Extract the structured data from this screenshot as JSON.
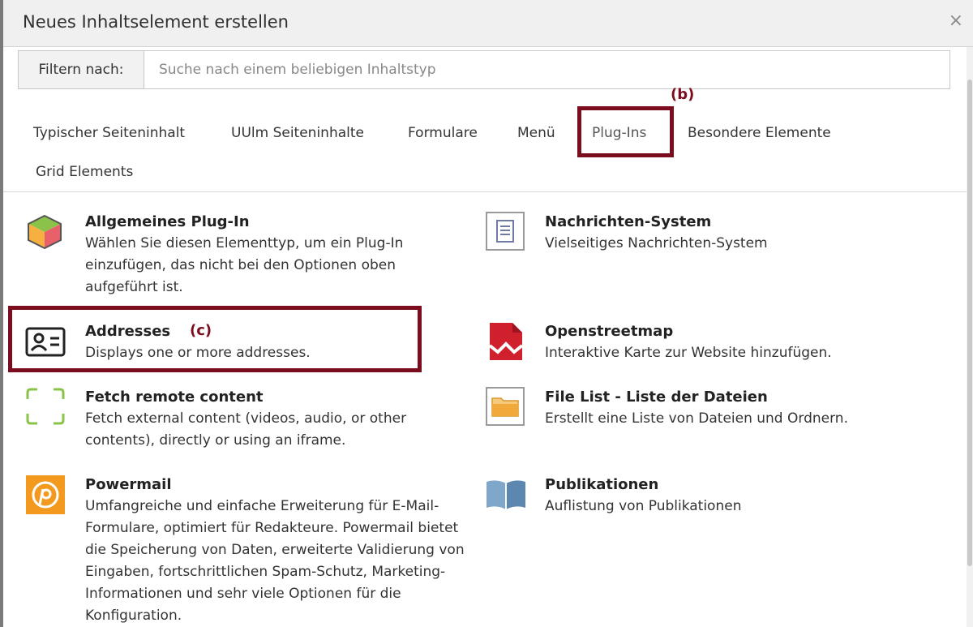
{
  "dialog": {
    "title": "Neues Inhaltselement erstellen",
    "close_glyph": "×"
  },
  "filter": {
    "label": "Filtern nach:",
    "placeholder": "Suche nach einem beliebigen Inhaltstyp",
    "value": ""
  },
  "tabs": [
    {
      "label": "Typischer Seiteninhalt"
    },
    {
      "label": "UUlm Seiteninhalte"
    },
    {
      "label": "Formulare"
    },
    {
      "label": "Menü"
    },
    {
      "label": "Plug-Ins",
      "active": true
    },
    {
      "label": "Besondere Elemente"
    },
    {
      "label": "Grid Elements"
    }
  ],
  "annotations": {
    "b": "(b)",
    "c": "(c)"
  },
  "items": [
    {
      "name": "Allgemeines Plug-In",
      "desc": "Wählen Sie diesen Elementtyp, um ein Plug-In einzufügen, das nicht bei den Optionen oben aufgeführt ist.",
      "icon": "plugin-cube-icon"
    },
    {
      "name": "Nachrichten-System",
      "desc": "Vielseitiges Nachrichten-System",
      "icon": "news-document-icon"
    },
    {
      "name": "Addresses",
      "desc": "Displays one or more addresses.",
      "icon": "address-card-icon"
    },
    {
      "name": "Openstreetmap",
      "desc": "Interaktive Karte zur Website hinzufügen.",
      "icon": "openstreetmap-icon"
    },
    {
      "name": "Fetch remote content",
      "desc": "Fetch external content (videos, audio, or other contents), directly or using an iframe.",
      "icon": "frame-corners-icon"
    },
    {
      "name": "File List - Liste der Dateien",
      "desc": "Erstellt eine Liste von Dateien und Ordnern.",
      "icon": "folder-icon"
    },
    {
      "name": "Powermail",
      "desc": "Umfangreiche und einfache Erweiterung für E-Mail-Formulare, optimiert für Redakteure. Powermail bietet die Speicherung von Daten, erweiterte Validierung von Eingaben, fortschrittlichen Spam-Schutz, Marketing-Informationen und sehr viele Optionen für die Konfiguration.",
      "icon": "powermail-icon"
    },
    {
      "name": "Publikationen",
      "desc": "Auflistung von Publikationen",
      "icon": "book-icon"
    }
  ],
  "colors": {
    "annotation": "#7b0d1e",
    "header_bg": "#f0f0f0",
    "powermail": "#f39a1e",
    "openstreetmap": "#d0202e"
  }
}
